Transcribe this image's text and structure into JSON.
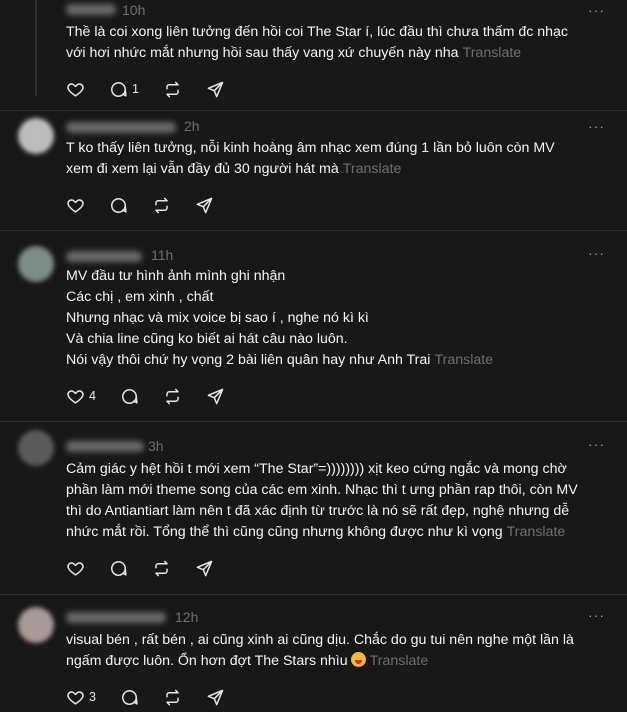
{
  "posts": [
    {
      "time": "10h",
      "lines": [
        "Thề là coi xong liên tưởng đến hồi coi The Star í, lúc đầu thì chưa thấm đc nhạc",
        "với hơi nhức mắt nhưng hồi sau thấy vang xứ chuyến này nha"
      ],
      "translate": "Translate",
      "likes": "",
      "replies": "1"
    },
    {
      "time": "2h",
      "lines": [
        "T ko thấy liên tưởng, nỗi kinh hoàng âm nhạc xem đúng 1 lần bỏ luôn còn MV",
        "xem đi xem lại vẫn đầy đủ 30 người hát mà"
      ],
      "translate": "Translate",
      "likes": "",
      "replies": ""
    },
    {
      "time": "11h",
      "lines": [
        "MV đầu tư hình ảnh mình ghi nhận",
        "Các chị , em xinh , chất",
        "Nhưng nhạc và mix voice bị sao í , nghe nó kì kì",
        "Và chia line cũng ko biết ai hát câu nào luôn.",
        "Nói vậy thôi chứ hy vọng 2 bài liên quân hay như Anh Trai"
      ],
      "translate": "Translate",
      "likes": "4",
      "replies": ""
    },
    {
      "time": "3h",
      "lines": [
        "Cảm giác y hệt hồi t mới xem “The Star”=)))))))) xịt keo cứng ngắc và mong chờ",
        "phần làm mới theme song của các em xinh. Nhạc thì t ưng phần rap thôi, còn MV",
        "thì do Antiantiart làm nên t đã xác định từ trước là nó sẽ rất đẹp, nghệ nhưng dễ",
        "nhức mắt rồi. Tổng thể thì cũng cũng nhưng không được như kì vọng"
      ],
      "translate": "Translate",
      "likes": "",
      "replies": ""
    },
    {
      "time": "12h",
      "lines": [
        "visual bén , rất bén , ai cũng xinh ai cũng dịu. Chắc do gu tui nên nghe một lần là",
        "ngấm được luôn. Ổn hơn đợt The Stars nhìu"
      ],
      "translate": "Translate",
      "likes": "3",
      "replies": ""
    }
  ],
  "more_glyph": "···",
  "emoji_icon": "grinning-face-emoji",
  "icons": [
    "heart-icon",
    "comment-icon",
    "repost-icon",
    "share-icon"
  ]
}
